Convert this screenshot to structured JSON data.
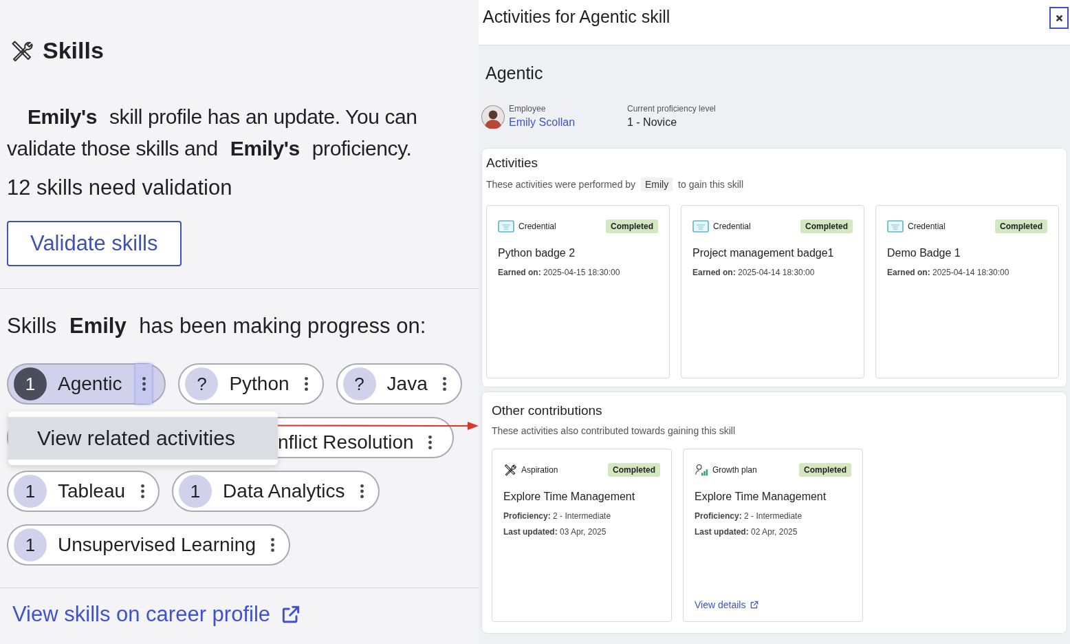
{
  "skills_page": {
    "title": "Skills",
    "update_text": "**Emily's** skill profile has an update. You can validate those skills and **Emily's** proficiency.",
    "validation_count": "12 skills need validation",
    "validate_button": "Validate skills",
    "progress_heading": "Skills **Emily** has been making progress on:",
    "skills": [
      {
        "kind": "pill",
        "badge": "1",
        "label": "Agentic",
        "selected": true
      },
      {
        "kind": "pill",
        "badge": "?",
        "label": "Python",
        "selected": false
      },
      {
        "kind": "pill",
        "badge": "?",
        "label": "Java",
        "selected": false
      },
      {
        "kind": "covered",
        "label": "nflict Resolution",
        "selected": false
      },
      {
        "kind": "pill",
        "badge": "1",
        "label": "Tableau",
        "selected": false
      },
      {
        "kind": "pill",
        "badge": "1",
        "label": "Data Analytics",
        "selected": false
      },
      {
        "kind": "pill",
        "badge": "1",
        "label": "Unsupervised Learning",
        "selected": false
      }
    ],
    "context_menu": {
      "items": [
        {
          "label": "View related activities",
          "selected": true
        }
      ]
    },
    "career_link": "View skills on career profile"
  },
  "panel": {
    "title": "Activities for Agentic skill",
    "skill": "Agentic",
    "employee_label": "Employee",
    "employee_name": "Emily Scollan",
    "proficiency_label": "Current proficiency level",
    "proficiency": "1 - Novice",
    "activities": {
      "title": "Activities",
      "subtitle": "These activities were performed by **Emily** to gain this skill",
      "cards": [
        {
          "kind": "credential",
          "type": "Credential",
          "status": "Completed",
          "name": "Python badge 2",
          "lines": [
            {
              "label": "Earned on:",
              "value": "2025-04-15 18:30:00"
            }
          ]
        },
        {
          "kind": "credential",
          "type": "Credential",
          "status": "Completed",
          "name": "Project management badge1",
          "lines": [
            {
              "label": "Earned on:",
              "value": "2025-04-14 18:30:00"
            }
          ]
        },
        {
          "kind": "credential",
          "type": "Credential",
          "status": "Completed",
          "name": "Demo Badge 1",
          "lines": [
            {
              "label": "Earned on:",
              "value": "2025-04-14 18:30:00"
            }
          ]
        }
      ]
    },
    "contributions": {
      "title": "Other contributions",
      "subtitle": "These activities also contributed towards gaining this skill",
      "cards": [
        {
          "kind": "aspiration",
          "type": "Aspiration",
          "status": "Completed",
          "name": "Explore Time Management",
          "lines": [
            {
              "label": "Proficiency:",
              "value": "2 - Intermediate"
            },
            {
              "label": "Last updated:",
              "value": "03 Apr, 2025"
            }
          ]
        },
        {
          "kind": "growth",
          "type": "Growth plan",
          "status": "Completed",
          "name": "Explore Time Management",
          "lines": [
            {
              "label": "Proficiency:",
              "value": "2 - Intermediate"
            },
            {
              "label": "Last updated:",
              "value": "02 Apr, 2025"
            }
          ],
          "link": "View details"
        }
      ]
    }
  }
}
